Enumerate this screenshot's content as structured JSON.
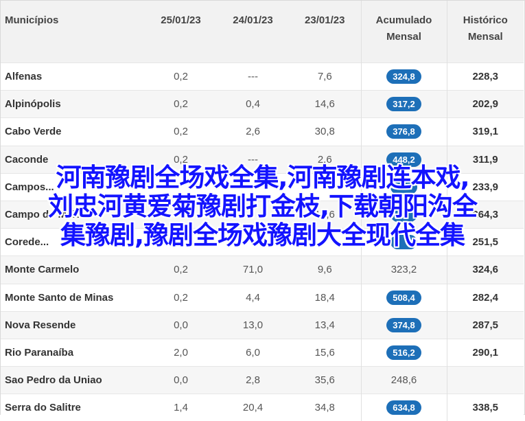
{
  "headers": [
    {
      "l1": "Municípios",
      "l2": ""
    },
    {
      "l1": "25/01/23",
      "l2": ""
    },
    {
      "l1": "24/01/23",
      "l2": ""
    },
    {
      "l1": "23/01/23",
      "l2": ""
    },
    {
      "l1": "Acumulado",
      "l2": "Mensal"
    },
    {
      "l1": "Histórico",
      "l2": "Mensal"
    }
  ],
  "rows": [
    {
      "name": "Alfenas",
      "d25": "0,2",
      "d24": "---",
      "d23": "7,6",
      "acc": "324,8",
      "acc_badge": true,
      "hist": "228,3"
    },
    {
      "name": "Alpinópolis",
      "d25": "0,2",
      "d24": "0,4",
      "d23": "14,6",
      "acc": "317,2",
      "acc_badge": true,
      "hist": "202,9"
    },
    {
      "name": "Cabo Verde",
      "d25": "0,2",
      "d24": "2,6",
      "d23": "30,8",
      "acc": "376,8",
      "acc_badge": true,
      "hist": "319,1"
    },
    {
      "name": "Caconde",
      "d25": "0,2",
      "d24": "---",
      "d23": "2,6",
      "acc": "448,2",
      "acc_badge": true,
      "hist": "311,9"
    },
    {
      "name": "Campos...",
      "d25": "",
      "d24": "",
      "d23": "",
      "acc": "",
      "acc_badge": true,
      "hist": "233,9"
    },
    {
      "name": "Campo do Meio",
      "d25": "",
      "d24": "",
      "d23": "12,6",
      "acc": "",
      "acc_badge": true,
      "hist": "264,3"
    },
    {
      "name": "Corede...",
      "d25": "",
      "d24": "",
      "d23": "",
      "acc": "",
      "acc_badge": true,
      "hist": "251,5"
    },
    {
      "name": "Monte Carmelo",
      "d25": "0,2",
      "d24": "71,0",
      "d23": "9,6",
      "acc": "323,2",
      "acc_badge": false,
      "hist": "324,6"
    },
    {
      "name": "Monte Santo de Minas",
      "d25": "0,2",
      "d24": "4,4",
      "d23": "18,4",
      "acc": "508,4",
      "acc_badge": true,
      "hist": "282,4"
    },
    {
      "name": "Nova Resende",
      "d25": "0,0",
      "d24": "13,0",
      "d23": "13,4",
      "acc": "374,8",
      "acc_badge": true,
      "hist": "287,5"
    },
    {
      "name": "Rio Paranaíba",
      "d25": "2,0",
      "d24": "6,0",
      "d23": "15,6",
      "acc": "516,2",
      "acc_badge": true,
      "hist": "290,1"
    },
    {
      "name": "Sao Pedro da Uniao",
      "d25": "0,0",
      "d24": "2,8",
      "d23": "35,6",
      "acc": "248,6",
      "acc_badge": false,
      "hist": ""
    },
    {
      "name": "Serra do Salitre",
      "d25": "1,4",
      "d24": "20,4",
      "d23": "34,8",
      "acc": "634,8",
      "acc_badge": true,
      "hist": "338,5"
    }
  ],
  "overlay": {
    "line1": "河南豫剧全场戏全集,河南豫剧连本戏,",
    "line2": "刘忠河黄爱菊豫剧打金枝,下载朝阳沟全",
    "line3": "集豫剧,豫剧全场戏豫剧大全现代全集"
  },
  "colors": {
    "badge": "#1d6fb8",
    "overlay_text": "#1313ff",
    "header_bg": "#f2f2f2"
  }
}
